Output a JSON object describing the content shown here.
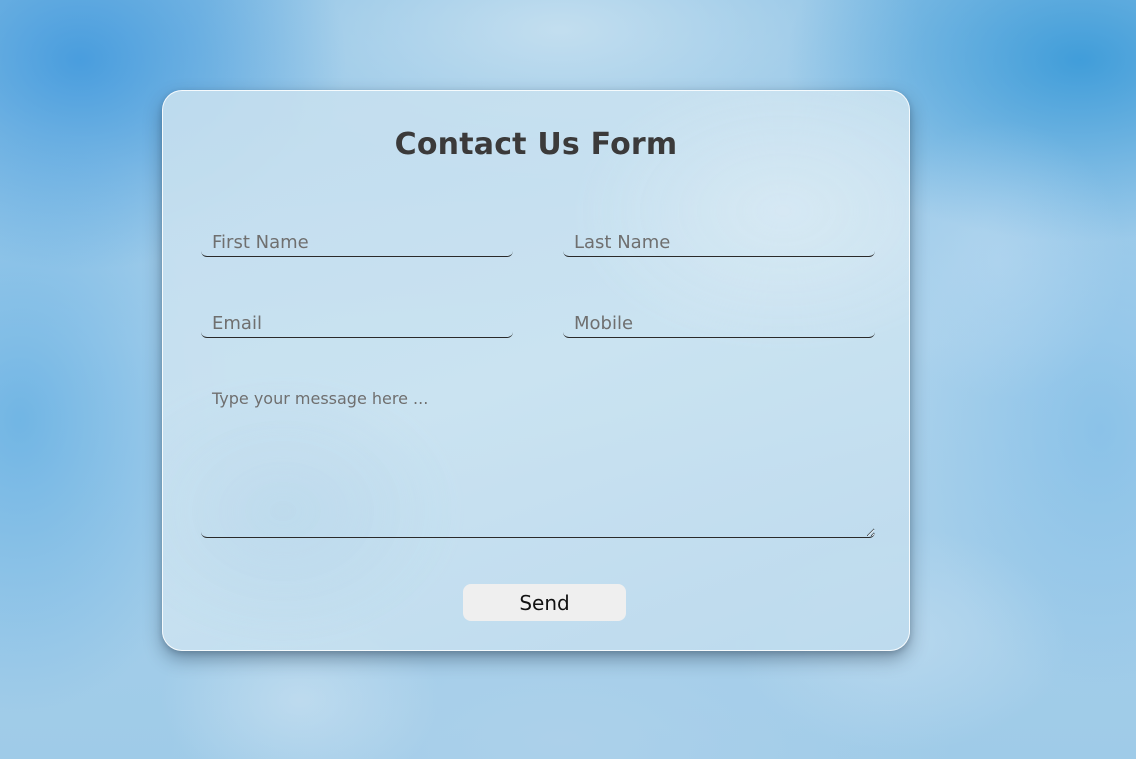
{
  "form": {
    "title": "Contact Us Form",
    "first_name_placeholder": "First Name",
    "last_name_placeholder": "Last Name",
    "email_placeholder": "Email",
    "mobile_placeholder": "Mobile",
    "message_placeholder": "Type your message here ...",
    "send_label": "Send"
  },
  "colors": {
    "title_text": "#3b3a3a",
    "send_button_bg": "#efefef",
    "field_underline": "#2a2a2a"
  }
}
